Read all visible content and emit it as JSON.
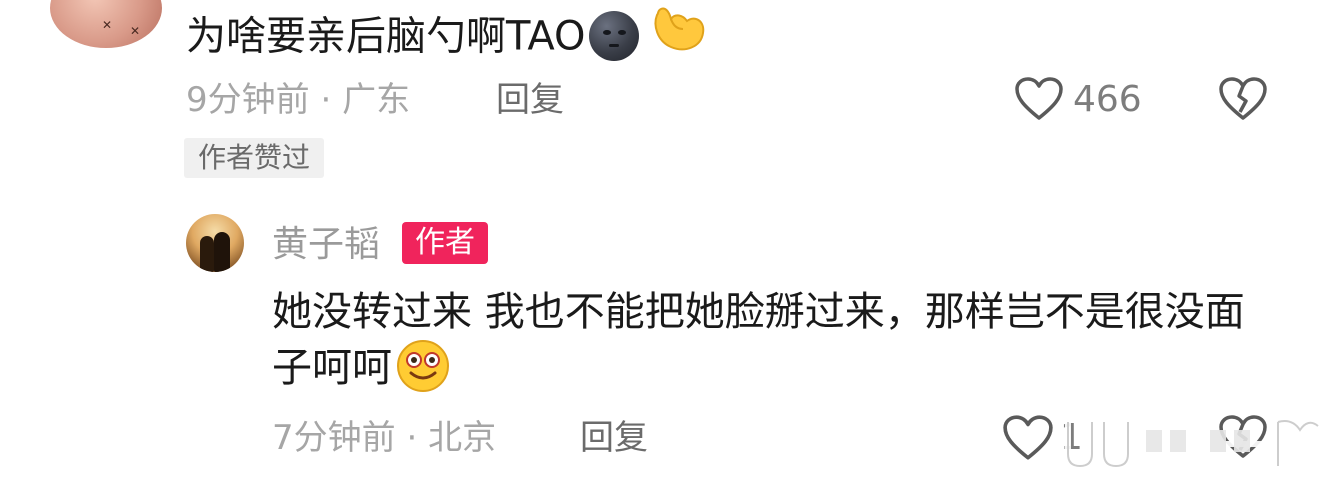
{
  "top_comment": {
    "text": "为啥要亲后脑勺啊TAO",
    "emojis": [
      "new-moon-face-emoji",
      "flexed-biceps-emoji"
    ],
    "time": "9分钟前",
    "separator": "·",
    "location": "广东",
    "reply_label": "回复",
    "like_count": "466",
    "author_liked_label": "作者赞过"
  },
  "reply_comment": {
    "username": "黄子韬",
    "author_badge": "作者",
    "text": "她没转过来 我也不能把她脸掰过来，那样岂不是很没面子呵呵",
    "emoji": "flushed-smile-emoji",
    "time": "7分钟前",
    "separator": "·",
    "location": "北京",
    "reply_label": "回复",
    "like_count": "1"
  },
  "colors": {
    "author_badge_bg": "#f0245c",
    "meta_text": "#a6a6a6",
    "reply_text": "#6b6b6b",
    "author_liked_bg": "#f0f0f0"
  }
}
